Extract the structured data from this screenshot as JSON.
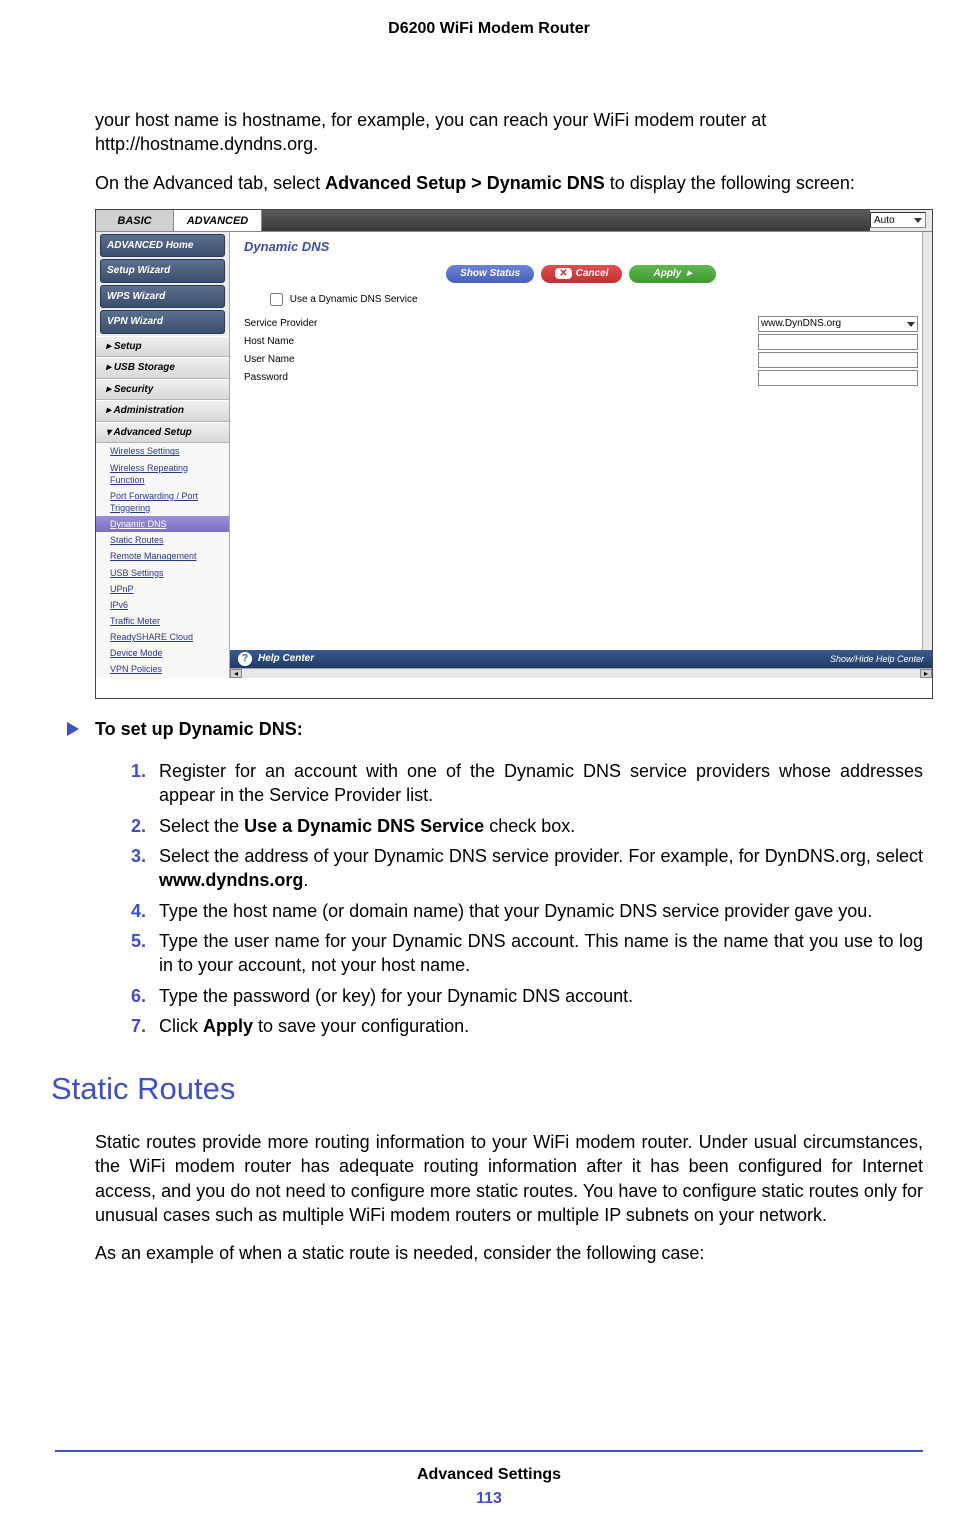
{
  "page": {
    "header": "D6200 WiFi Modem Router",
    "footer_section": "Advanced Settings",
    "page_number": "113"
  },
  "body": {
    "p1": "your host name is hostname, for example, you can reach your WiFi modem router at http://hostname.dyndns.org.",
    "p2a": "On the Advanced tab, select ",
    "p2b": "Advanced Setup > Dynamic DNS",
    "p2c": " to display the following screen:"
  },
  "screenshot": {
    "tab_basic": "BASIC",
    "tab_advanced": "ADVANCED",
    "top_select": "Auto",
    "sidebar": {
      "box1": "ADVANCED Home",
      "box2": "Setup Wizard",
      "box3": "WPS Wizard",
      "box4": "VPN Wizard",
      "items": [
        "Setup",
        "USB Storage",
        "Security",
        "Administration",
        "Advanced Setup"
      ],
      "subs": [
        "Wireless Settings",
        "Wireless Repeating Function",
        "Port Forwarding / Port Triggering",
        "Dynamic DNS",
        "Static Routes",
        "Remote Management",
        "USB Settings",
        "UPnP",
        "IPv6",
        "Traffic Meter",
        "ReadySHARE Cloud",
        "Device Mode",
        "VPN Policies"
      ]
    },
    "main": {
      "title": "Dynamic DNS",
      "btn_status": "Show Status",
      "btn_cancel_x": "✕",
      "btn_cancel": "Cancel",
      "btn_apply": "Apply",
      "cb_label": "Use a Dynamic DNS Service",
      "row1": "Service Provider",
      "row1_val": "www.DynDNS.org",
      "row2": "Host Name",
      "row3": "User Name",
      "row4": "Password"
    },
    "help": {
      "title": "Help Center",
      "right": "Show/Hide Help Center"
    }
  },
  "proc": {
    "title": "To set up Dynamic DNS:",
    "steps": {
      "s1": "Register for an account with one of the Dynamic DNS service providers whose addresses appear in the Service Provider list.",
      "s2a": "Select the ",
      "s2b": "Use a Dynamic DNS Service",
      "s2c": " check box.",
      "s3a": "Select the address of your Dynamic DNS service provider. For example, for DynDNS.org, select ",
      "s3b": "www.dyndns.org",
      "s3c": ".",
      "s4": "Type the host name (or domain name) that your Dynamic DNS service provider gave you.",
      "s5": "Type the user name for your Dynamic DNS account. This name is the name that you use to log in to your account, not your host name.",
      "s6": "Type the password (or key) for your Dynamic DNS account.",
      "s7a": "Click ",
      "s7b": "Apply",
      "s7c": " to save your configuration."
    }
  },
  "section": {
    "h2": "Static Routes",
    "p1": "Static routes provide more routing information to your WiFi modem router. Under usual circumstances, the WiFi modem router has adequate routing information after it has been configured for Internet access, and you do not need to configure more static routes. You have to configure static routes only for unusual cases such as multiple WiFi modem routers or multiple IP subnets on your network.",
    "p2": "As an example of when a static route is needed, consider the following case:"
  }
}
